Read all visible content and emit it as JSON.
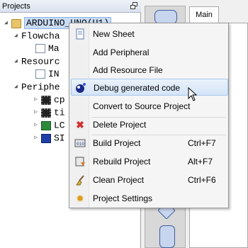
{
  "panel": {
    "title": "Projects"
  },
  "tree": {
    "root": "ARDUINO_UNO(U1)",
    "flowchart": "Flowcha",
    "flowchart_child": "Ma",
    "resources": "Resourc",
    "resources_child": "IN",
    "peripherals": "Periphe",
    "p1": "cp",
    "p2": "ti",
    "p3": "LC",
    "p4": "SI"
  },
  "tabs": {
    "main": "Main"
  },
  "menu": {
    "new_sheet": "New Sheet",
    "add_peripheral": "Add Peripheral",
    "add_resource_file": "Add Resource File",
    "debug_generated_code": "Debug generated code",
    "convert_to_source": "Convert to Source Project",
    "delete_project": "Delete Project",
    "build_project": "Build Project",
    "build_shortcut": "Ctrl+F7",
    "rebuild_project": "Rebuild Project",
    "rebuild_shortcut": "Alt+F7",
    "clean_project": "Clean Project",
    "clean_shortcut": "Ctrl+F6",
    "project_settings": "Project Settings"
  },
  "colors": {
    "highlight": "#d4e4f7",
    "delete_icon": "#d03030",
    "settings_icon": "#e09a1a"
  }
}
